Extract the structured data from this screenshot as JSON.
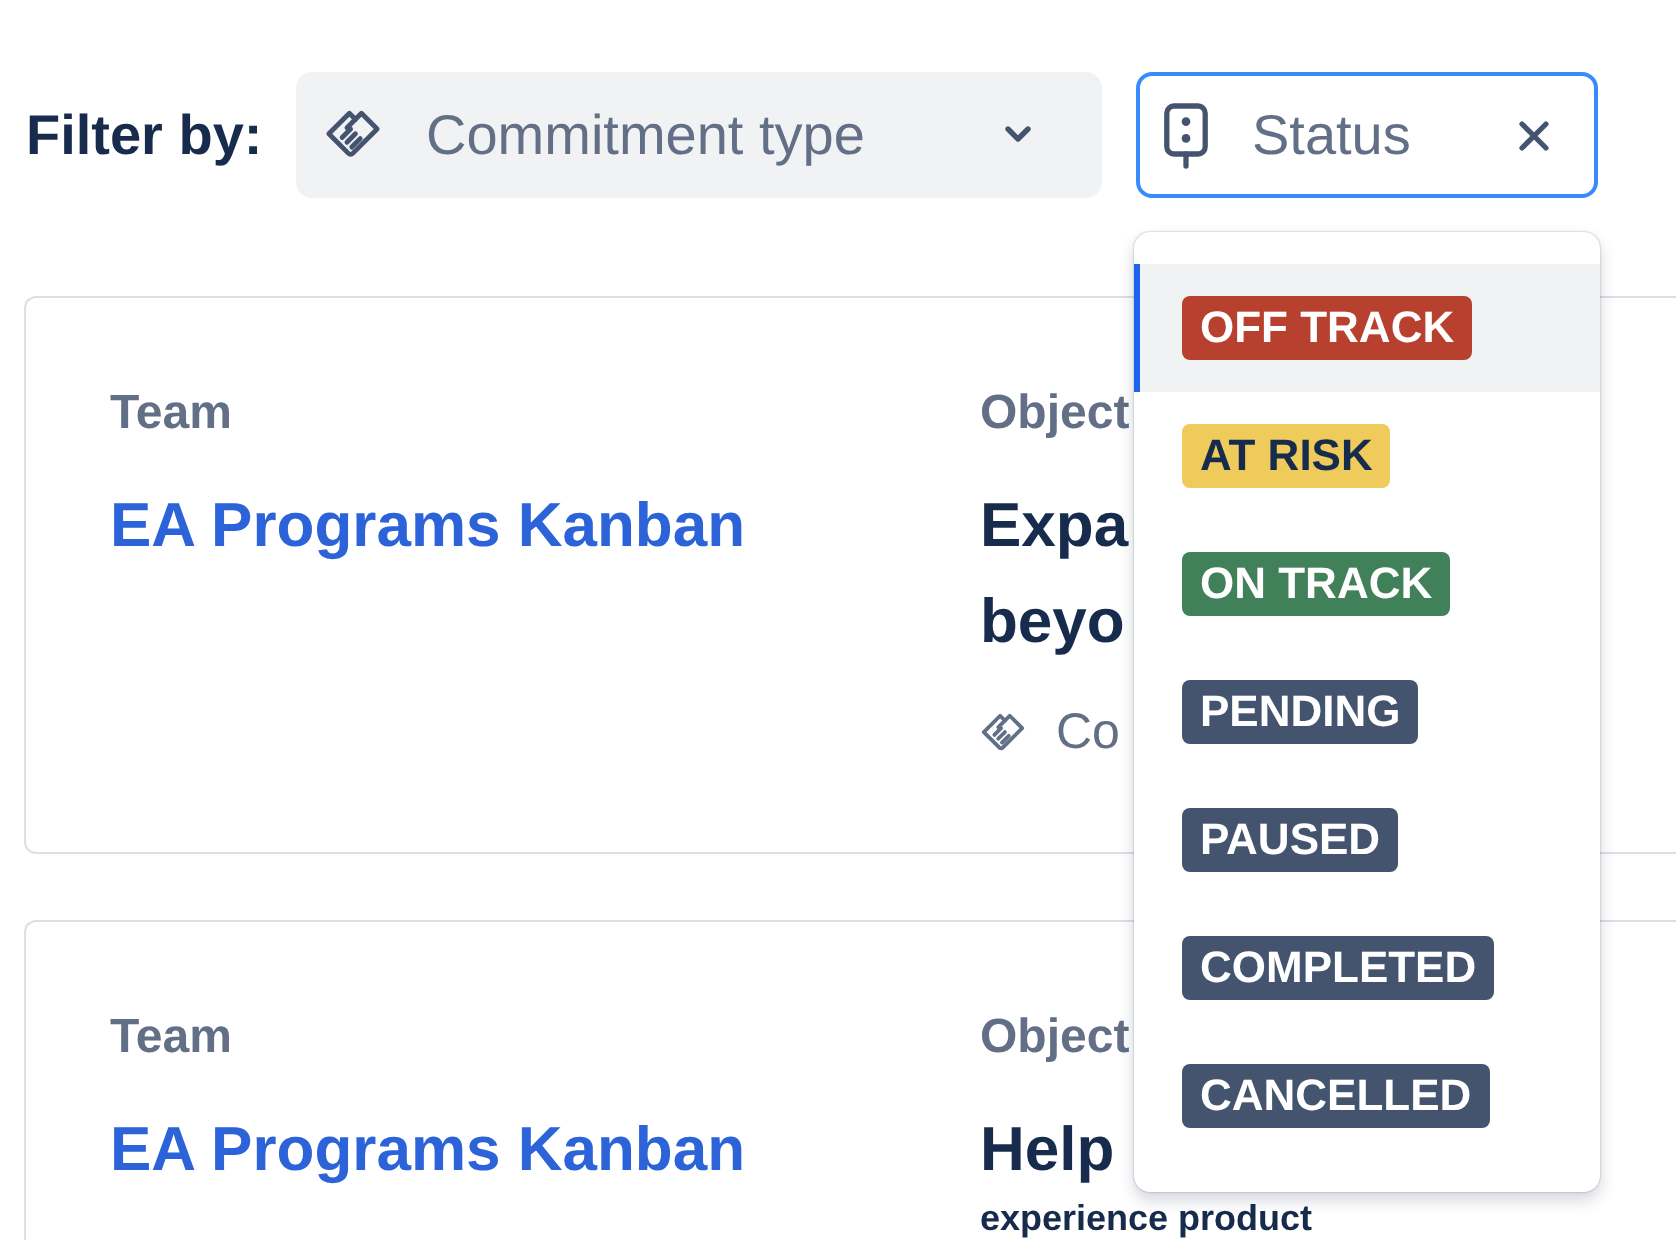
{
  "filter_bar": {
    "label": "Filter by:",
    "filters": [
      {
        "kind": "select",
        "placeholder": "Commitment type",
        "focused": false
      },
      {
        "kind": "clearable",
        "placeholder": "Status",
        "focused": true,
        "expanded": true,
        "options": [
          {
            "label": "OFF TRACK",
            "color": "#b8402f",
            "selected": true
          },
          {
            "label": "AT RISK",
            "color": "#eecb5b",
            "selected": false
          },
          {
            "label": "ON TRACK",
            "color": "#41815a",
            "selected": false
          },
          {
            "label": "PENDING",
            "color": "#44546f",
            "selected": false
          },
          {
            "label": "PAUSED",
            "color": "#44546f",
            "selected": false
          },
          {
            "label": "COMPLETED",
            "color": "#44546f",
            "selected": false
          },
          {
            "label": "CANCELLED",
            "color": "#44546f",
            "selected": false
          }
        ]
      }
    ]
  },
  "cards": [
    {
      "columns": [
        {
          "kind": "link",
          "heading": "Team",
          "lines": [
            "EA Programs Kanban"
          ]
        },
        {
          "kind": "title",
          "heading": "Object",
          "lines": [
            "Expa",
            "beyo"
          ],
          "meta": "Co"
        }
      ]
    },
    {
      "columns": [
        {
          "kind": "link",
          "heading": "Team",
          "lines": [
            "EA Programs Kanban"
          ]
        },
        {
          "kind": "title",
          "heading": "Object",
          "lines": [
            "Help",
            "experience product"
          ]
        }
      ]
    }
  ]
}
